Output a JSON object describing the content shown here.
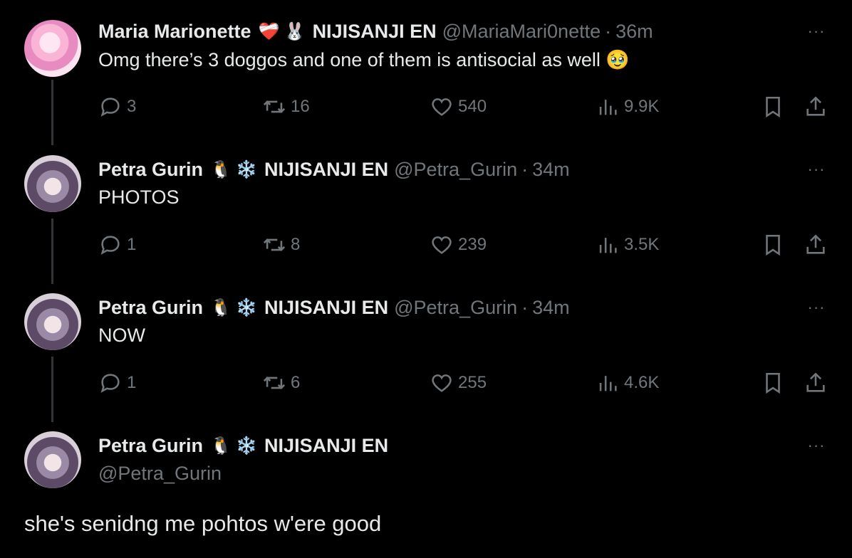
{
  "tweets": [
    {
      "name": "Maria Marionette",
      "emoji1": "❤️‍🩹",
      "emoji2": "🐰",
      "org": "NIJISANJI EN",
      "handle": "@MariaMari0nette",
      "time": "36m",
      "text": "Omg there’s 3 doggos and one of them is antisocial as well 🥹",
      "replies": "3",
      "retweets": "16",
      "likes": "540",
      "views": "9.9K"
    },
    {
      "name": "Petra Gurin",
      "emoji1": "🐧",
      "emoji2": "❄️",
      "org": "NIJISANJI EN",
      "handle": "@Petra_Gurin",
      "time": "34m",
      "text": "PHOTOS",
      "replies": "1",
      "retweets": "8",
      "likes": "239",
      "views": "3.5K"
    },
    {
      "name": "Petra Gurin",
      "emoji1": "🐧",
      "emoji2": "❄️",
      "org": "NIJISANJI EN",
      "handle": "@Petra_Gurin",
      "time": "34m",
      "text": "NOW",
      "replies": "1",
      "retweets": "6",
      "likes": "255",
      "views": "4.6K"
    }
  ],
  "main_tweet": {
    "name": "Petra Gurin",
    "emoji1": "🐧",
    "emoji2": "❄️",
    "org": "NIJISANJI EN",
    "handle": "@Petra_Gurin",
    "text": "she's senidng me pohtos w'ere good"
  },
  "dot": "·",
  "more_label": "···",
  "icons": {
    "reply": "reply-icon",
    "retweet": "retweet-icon",
    "like": "heart-icon",
    "views": "views-icon",
    "bookmark": "bookmark-icon",
    "share": "share-icon",
    "more": "more-icon"
  },
  "colors": {
    "background": "#000000",
    "text": "#e7e9ea",
    "muted": "#71767b"
  }
}
